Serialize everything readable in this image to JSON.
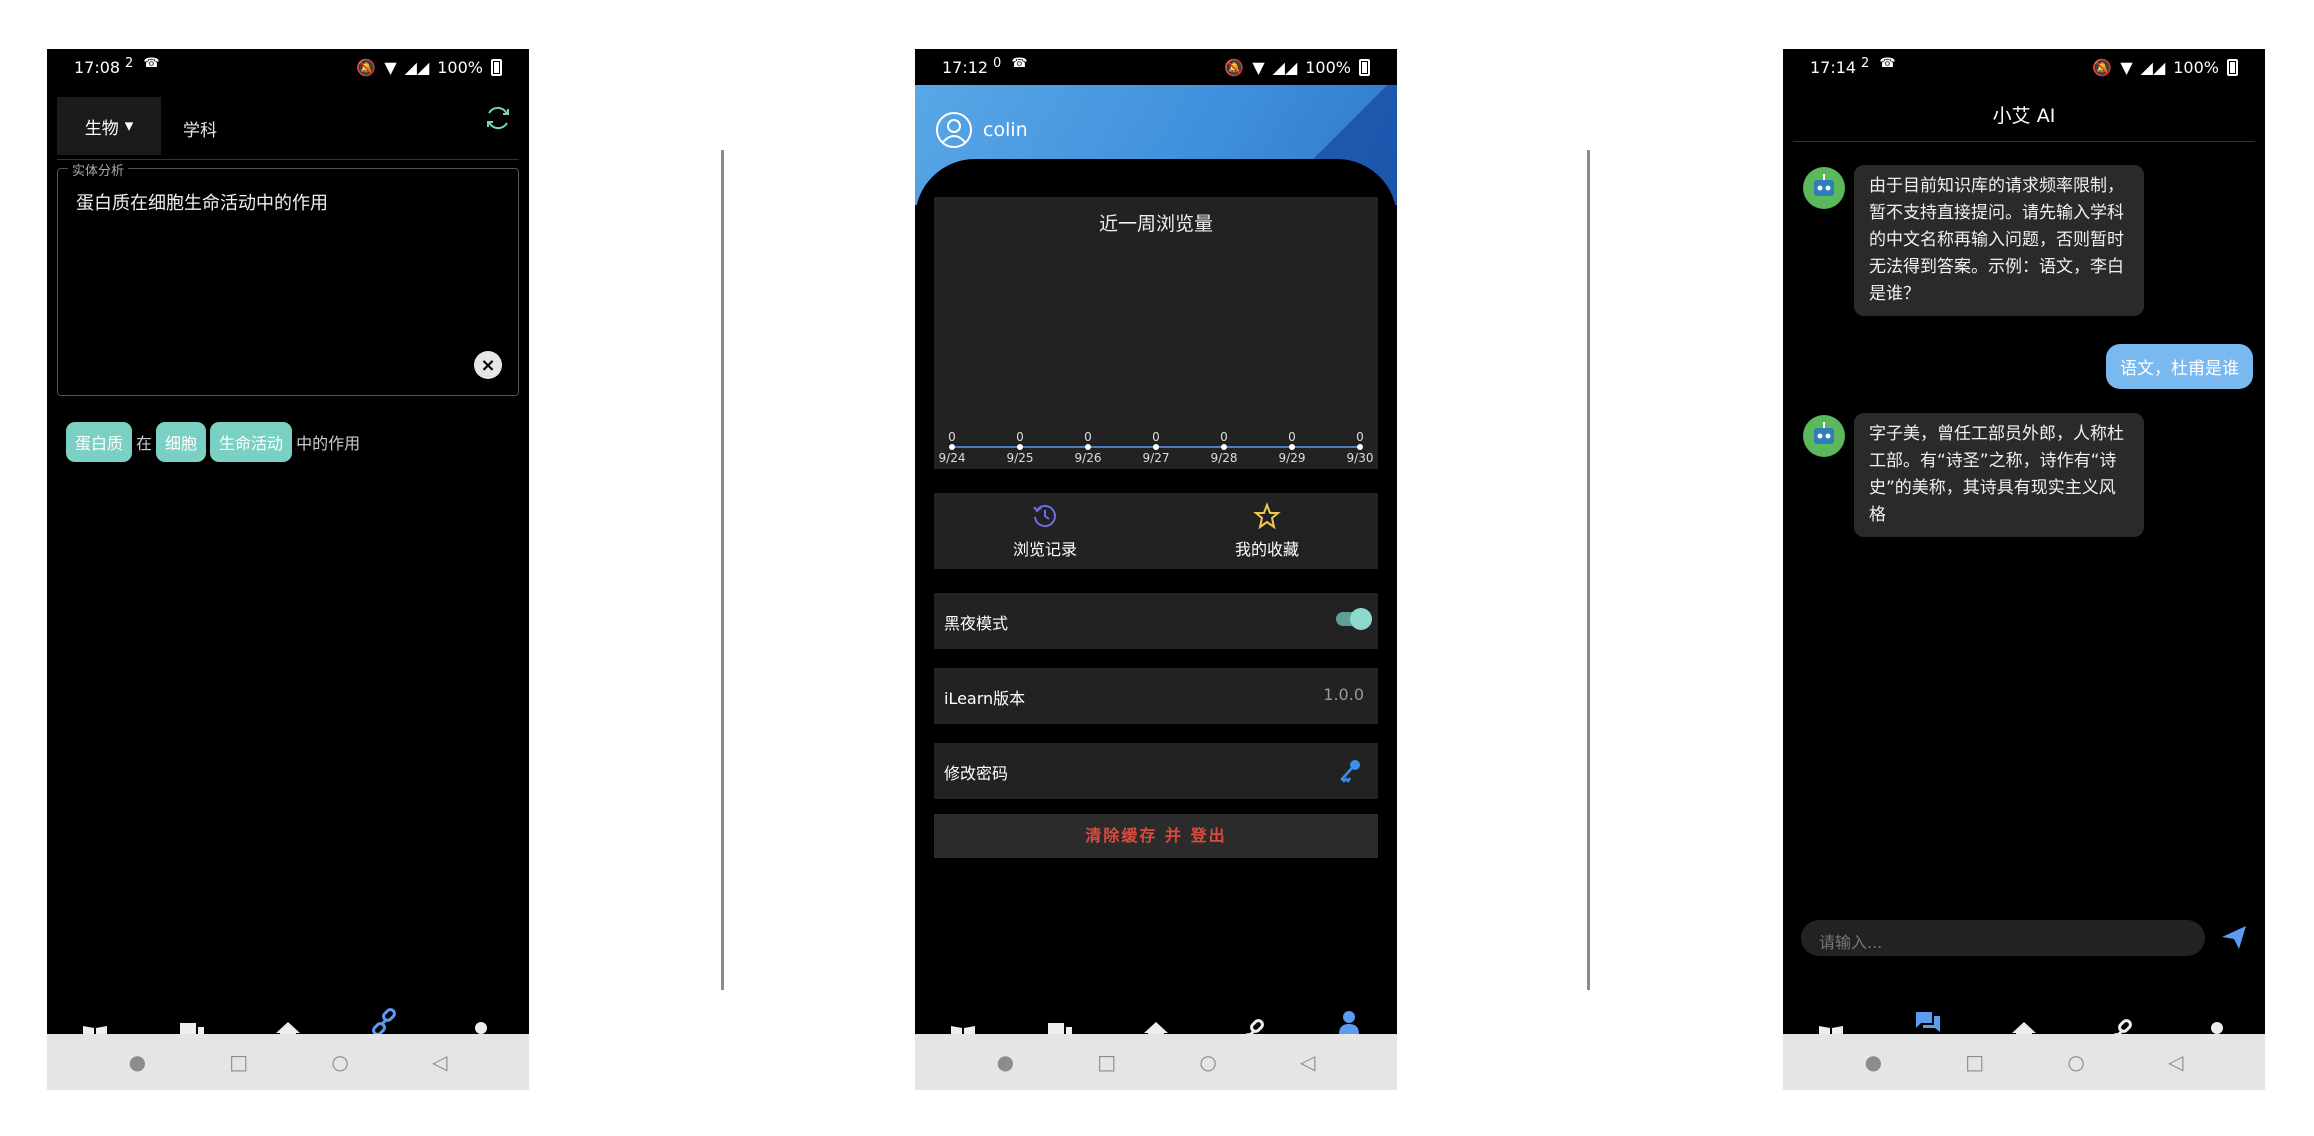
{
  "screens": [
    {
      "status": {
        "time": "17:08",
        "net": "2",
        "battery": "100%"
      },
      "subject_dropdown": "生物",
      "tab_label": "学科",
      "field_legend": "实体分析",
      "field_value": "蛋白质在细胞生命活动中的作用",
      "entities": [
        {
          "text": "蛋白质",
          "chip": true
        },
        {
          "text": "在",
          "chip": false
        },
        {
          "text": "细胞",
          "chip": true
        },
        {
          "text": "生命活动",
          "chip": true
        },
        {
          "text": "中的作用",
          "chip": false
        }
      ],
      "nav_active_label": "链接"
    },
    {
      "status": {
        "time": "17:12",
        "net": "0",
        "battery": "100%"
      },
      "username": "colin",
      "chart_title": "近一周浏览量",
      "shortcuts": [
        "浏览记录",
        "我的收藏"
      ],
      "dark_mode_label": "黑夜模式",
      "dark_mode_on": true,
      "version_label": "iLearn版本",
      "version_value": "1.0.0",
      "password_label": "修改密码",
      "logout_label": "清除缓存 并 登出",
      "nav_active_label": "我"
    },
    {
      "status": {
        "time": "17:14",
        "net": "2",
        "battery": "100%"
      },
      "chat_title": "小艾 AI",
      "messages": [
        {
          "from": "ai",
          "text": "由于目前知识库的请求频率限制，暂不支持直接提问。请先输入学科的中文名称再输入问题，否则暂时无法得到答案。示例：语文，李白是谁？"
        },
        {
          "from": "me",
          "text": "语文，杜甫是谁"
        },
        {
          "from": "ai",
          "text": "字子美，曾任工部员外郎，人称杜工部。有“诗圣”之称，诗作有“诗史”的美称，其诗具有现实主义风格"
        }
      ],
      "input_placeholder": "请输入...",
      "nav_active_label": "问答"
    }
  ],
  "chart_data": {
    "type": "line",
    "title": "近一周浏览量",
    "categories": [
      "9/24",
      "9/25",
      "9/26",
      "9/27",
      "9/28",
      "9/29",
      "9/30"
    ],
    "values": [
      0,
      0,
      0,
      0,
      0,
      0,
      0
    ]
  },
  "colors": {
    "accent": "#5b9bf0",
    "chip": "#7ad0c2",
    "logout": "#d94b3d",
    "me_bubble": "#7ab8f0"
  }
}
